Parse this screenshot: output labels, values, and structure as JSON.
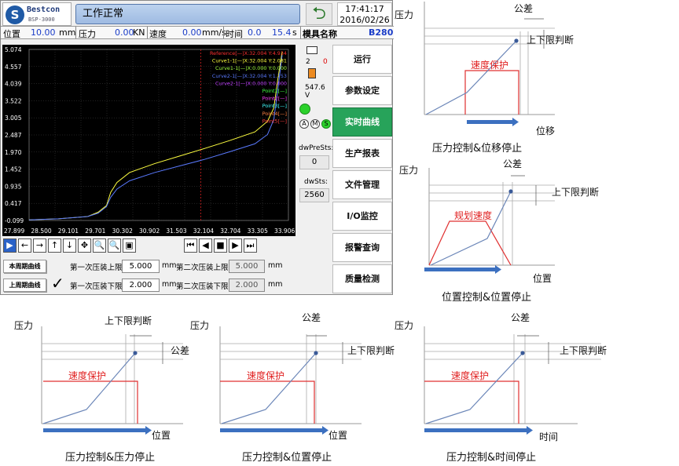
{
  "hmi": {
    "brand": "Bestcon",
    "model": "BSP-3000",
    "logo_glyph": "S",
    "status_text": "工作正常",
    "time": "17:41:17",
    "date": "2016/02/26",
    "info": {
      "pos_label": "位置",
      "pos_value": "10.00",
      "pos_unit": "mm",
      "force_label": "压力",
      "force_value": "0.00",
      "force_unit": "KN",
      "speed_label": "速度",
      "speed_value": "0.00",
      "speed_unit": "mm/s",
      "time_label": "时间",
      "time_value1": "0.0",
      "time_value2": "15.4",
      "time_unit": "s",
      "mold_label": "模具名称",
      "mold_value": "B280"
    },
    "side": {
      "counter_left": "2",
      "counter_right": "0",
      "voltage": "547.6 V",
      "mode_a": "A",
      "mode_m": "M",
      "mode_s": "S",
      "dwprests_label": "dwPreSts:",
      "dwprests_value": "0",
      "dwsts_label": "dwSts:",
      "dwsts_value": "2560"
    },
    "menu": [
      "运行",
      "参数设定",
      "实时曲线",
      "生产报表",
      "文件管理",
      "I/O监控",
      "报警查询",
      "质量检测"
    ],
    "menu_active_index": 2,
    "limits": {
      "btn_this": "本周期曲线",
      "btn_last": "上周期曲线",
      "first_upper_label": "第一次压装上限",
      "first_upper_value": "5.000",
      "second_upper_label": "第二次压装上限",
      "second_upper_value": "5.000",
      "first_lower_label": "第一次压装下限",
      "first_lower_value": "2.000",
      "second_lower_label": "第二次压装下限",
      "second_lower_value": "2.000",
      "unit": "mm",
      "check": "✓"
    },
    "toolbar_glyphs": [
      "▶",
      "←",
      "→",
      "↑",
      "↓",
      "✥",
      "🔍",
      "🔍",
      "▣",
      "⏮",
      "◀",
      "■",
      "▶",
      "⏭"
    ]
  },
  "chart_data": {
    "type": "line",
    "y_ticks": [
      "5.074",
      "4.557",
      "4.039",
      "3.522",
      "3.005",
      "2.487",
      "1.970",
      "1.452",
      "0.935",
      "0.417",
      "-0.099"
    ],
    "x_ticks": [
      "27.899",
      "28.500",
      "29.101",
      "29.701",
      "30.302",
      "30.902",
      "31.503",
      "32.104",
      "32.704",
      "33.305",
      "33.906"
    ],
    "ylim": [
      -0.099,
      5.074
    ],
    "xlim": [
      27.899,
      34.1
    ],
    "legend": [
      {
        "text": "Reference[—]X:32.004 Y:4.934",
        "color": "#ff3030"
      },
      {
        "text": "Curve1-1[—]X:32.004 Y:2.081",
        "color": "#ffff40"
      },
      {
        "text": "Curve1-1[—]X:0.000 Y:0.000",
        "color": "#a0ff40"
      },
      {
        "text": "Curve2-1[—]X:32.004 Y:1.753",
        "color": "#5a7aff"
      },
      {
        "text": "Curve2-1[—]X:0.000 Y:0.000",
        "color": "#c040ff"
      },
      {
        "text": "Point1[—]",
        "color": "#40ff40"
      },
      {
        "text": "Point2[—]",
        "color": "#ff40ff"
      },
      {
        "text": "Point3[—]",
        "color": "#40ffff"
      },
      {
        "text": "Point4[—]",
        "color": "#ff8040"
      },
      {
        "text": "Point5[—]",
        "color": "#ff4040"
      }
    ],
    "reference_x": 32.004,
    "series": [
      {
        "color": "#ffff40",
        "x": [
          27.899,
          28.6,
          29.3,
          29.55,
          29.75,
          29.85,
          30.0,
          30.3,
          30.9,
          31.5,
          32.1,
          32.7,
          33.3,
          33.6,
          33.75,
          33.85,
          33.95
        ],
        "y": [
          -0.08,
          -0.05,
          0.02,
          0.15,
          0.35,
          0.75,
          1.05,
          1.35,
          1.62,
          1.85,
          2.08,
          2.32,
          2.58,
          2.9,
          3.3,
          4.2,
          5.0
        ]
      },
      {
        "color": "#5a7aff",
        "x": [
          27.899,
          28.6,
          29.3,
          29.55,
          29.75,
          29.85,
          30.0,
          30.3,
          30.9,
          31.5,
          32.1,
          32.7,
          33.3,
          33.6,
          33.75,
          33.85,
          33.95
        ],
        "y": [
          -0.08,
          -0.05,
          0.02,
          0.12,
          0.32,
          0.6,
          0.85,
          1.1,
          1.35,
          1.55,
          1.75,
          1.98,
          2.22,
          2.5,
          2.95,
          3.9,
          4.9
        ]
      }
    ]
  },
  "diagrams": [
    {
      "id": "d1",
      "ylabel": "压力",
      "xlabel": "位移",
      "tol": "公差",
      "limit": "上下限判断",
      "red": "速度保护",
      "caption": "压力控制&位移停止"
    },
    {
      "id": "d2",
      "ylabel": "压力",
      "xlabel": "位置",
      "tol": "公差",
      "limit": "上下限判断",
      "red": "规划速度",
      "caption": "位置控制&位置停止"
    },
    {
      "id": "d3",
      "ylabel": "压力",
      "xlabel": "位置",
      "tol": "公差",
      "limit": "上下限判断",
      "red": "速度保护",
      "caption": "压力控制&压力停止"
    },
    {
      "id": "d4",
      "ylabel": "压力",
      "xlabel": "位置",
      "tol": "公差",
      "limit": "上下限判断",
      "red": "速度保护",
      "caption": "压力控制&位置停止"
    },
    {
      "id": "d5",
      "ylabel": "压力",
      "xlabel": "时间",
      "tol": "公差",
      "limit": "上下限判断",
      "red": "速度保护",
      "caption": "压力控制&时间停止"
    }
  ]
}
